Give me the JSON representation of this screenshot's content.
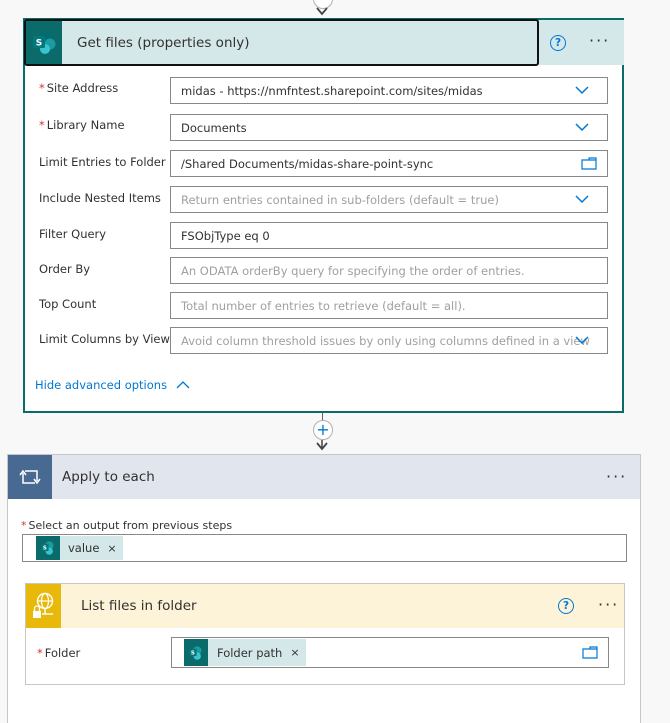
{
  "get_files_card": {
    "title": "Get files (properties only)",
    "icon": "sharepoint-icon",
    "help_icon": "help-icon",
    "more_icon": "more-options-icon",
    "more_label": "···",
    "help_label": "?",
    "fields": [
      {
        "label": "Site Address",
        "required": true,
        "value": "midas - https://nmfntest.sharepoint.com/sites/midas",
        "placeholder": "",
        "control": "dropdown"
      },
      {
        "label": "Library Name",
        "required": true,
        "value": "Documents",
        "placeholder": "",
        "control": "dropdown"
      },
      {
        "label": "Limit Entries to Folder",
        "required": false,
        "value": "/Shared Documents/midas-share-point-sync",
        "placeholder": "",
        "control": "folder-picker"
      },
      {
        "label": "Include Nested Items",
        "required": false,
        "value": "",
        "placeholder": "Return entries contained in sub-folders (default = true)",
        "control": "dropdown"
      },
      {
        "label": "Filter Query",
        "required": false,
        "value": "FSObjType eq 0",
        "placeholder": "",
        "control": "text"
      },
      {
        "label": "Order By",
        "required": false,
        "value": "",
        "placeholder": "An ODATA orderBy query for specifying the order of entries.",
        "control": "text"
      },
      {
        "label": "Top Count",
        "required": false,
        "value": "",
        "placeholder": "Total number of entries to retrieve (default = all).",
        "control": "text"
      },
      {
        "label": "Limit Columns by View",
        "required": false,
        "value": "",
        "placeholder": "Avoid column threshold issues by only using columns defined in a view",
        "control": "dropdown"
      }
    ],
    "advanced_toggle": "Hide advanced options"
  },
  "connector": {
    "add_label": "+"
  },
  "apply_to_each": {
    "title": "Apply to each",
    "icon": "loop-icon",
    "more_label": "···",
    "select_label": "Select an output from previous steps",
    "required_mark": "*",
    "token": {
      "label": "value",
      "remove": "×"
    }
  },
  "list_files_card": {
    "title": "List files in folder",
    "icon": "globe-lock-icon",
    "help_label": "?",
    "more_label": "···",
    "folder_label": "Folder",
    "required_mark": "*",
    "token": {
      "label": "Folder path",
      "remove": "×"
    }
  },
  "colors": {
    "sharepoint_teal": "#0b6a6a",
    "loop_blue": "#486991",
    "gateway_yellow": "#e8b90a",
    "accent_blue": "#0078d4",
    "required_red": "#d13438"
  }
}
